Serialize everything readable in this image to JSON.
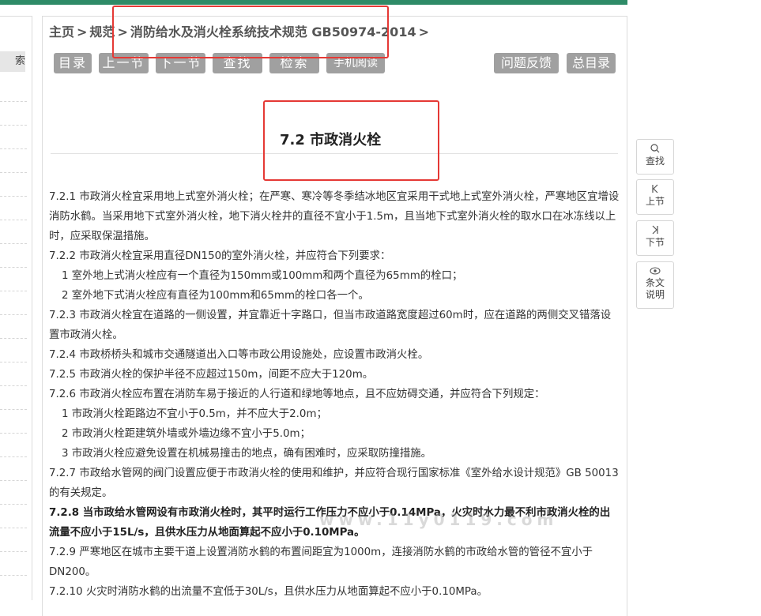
{
  "sidebar": {
    "search_stub": "索"
  },
  "breadcrumb": {
    "home": "主页",
    "sep": ">",
    "standards": "规范",
    "current": "消防给水及消火栓系统技术规范 GB50974-2014",
    "trail_sep": ">"
  },
  "toolbar": {
    "toc": "目录",
    "prev": "上一节",
    "next": "下一节",
    "find": "查找",
    "search": "检索",
    "mobile": "手机阅读",
    "feedback": "问题反馈",
    "all_toc": "总目录"
  },
  "section": {
    "title": "7.2 市政消火栓"
  },
  "content": {
    "p1": "7.2.1 市政消火栓宜采用地上式室外消火栓；在严寒、寒冷等冬季结冰地区宜采用干式地上式室外消火栓，严寒地区宜增设消防水鹤。当采用地下式室外消火栓，地下消火栓井的直径不宜小于1.5m，且当地下式室外消火栓的取水口在冰冻线以上时，应采取保温措施。",
    "p2": "7.2.2 市政消火栓宜采用直径DN150的室外消火栓，并应符合下列要求：",
    "p2_1": "1 室外地上式消火栓应有一个直径为150mm或100mm和两个直径为65mm的栓口；",
    "p2_2": "2 室外地下式消火栓应有直径为100mm和65mm的栓口各一个。",
    "p3": "7.2.3 市政消火栓宜在道路的一侧设置，并宜靠近十字路口，但当市政道路宽度超过60m时，应在道路的两侧交叉错落设置市政消火栓。",
    "p4": "7.2.4 市政桥桥头和城市交通隧道出入口等市政公用设施处，应设置市政消火栓。",
    "p5": "7.2.5 市政消火栓的保护半径不应超过150m，间距不应大于120m。",
    "p6": "7.2.6 市政消火栓应布置在消防车易于接近的人行道和绿地等地点，且不应妨碍交通，并应符合下列规定：",
    "p6_1": "1 市政消火栓距路边不宜小于0.5m，并不应大于2.0m；",
    "p6_2": "2 市政消火栓距建筑外墙或外墙边缘不宜小于5.0m；",
    "p6_3": "3 市政消火栓应避免设置在机械易撞击的地点，确有困难时，应采取防撞措施。",
    "p7": "7.2.7 市政给水管网的阀门设置应便于市政消火栓的使用和维护，并应符合现行国家标准《室外给水设计规范》GB 50013的有关规定。",
    "p8": "7.2.8 当市政给水管网设有市政消火栓时，其平时运行工作压力不应小于0.14MPa，火灾时水力最不利市政消火栓的出流量不应小于15L/s，且供水压力从地面算起不应小于0.10MPa。",
    "p9": "7.2.9 严寒地区在城市主要干道上设置消防水鹤的布置间距宜为1000m，连接消防水鹤的市政给水管的管径不宜小于DN200。",
    "p10": "7.2.10 火灾时消防水鹤的出流量不宜低于30L/s，且供水压力从地面算起不应小于0.10MPa。"
  },
  "watermark": "www.11y0119.com",
  "right_tools": {
    "find": "查找",
    "prev": "上节",
    "next": "下节",
    "notes_1": "条文",
    "notes_2": "说明",
    "find_icon": "search-icon",
    "prev_icon": "skip-previous-icon",
    "next_icon": "skip-next-icon",
    "notes_icon": "eye-icon"
  },
  "colors": {
    "topbar": "#2e8b67",
    "button": "#a0a0a0",
    "highlight": "#e53935"
  }
}
